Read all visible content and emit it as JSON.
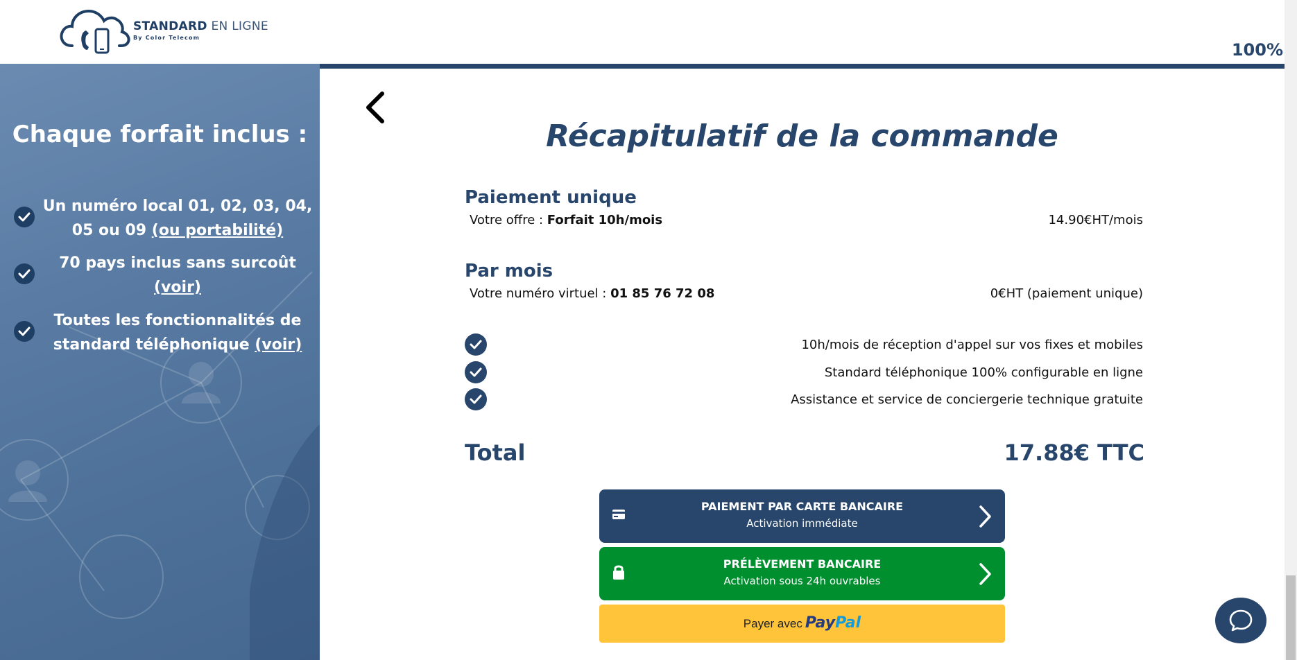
{
  "header": {
    "brand_bold": "STANDARD",
    "brand_light": "EN LIGNE",
    "brand_sub": "By Color Telecom",
    "logo_icon": "cloud-phone-icon",
    "progress_label": "100%",
    "progress_fraction": 1.0
  },
  "sidebar": {
    "title": "Chaque forfait inclus :",
    "features": [
      {
        "line1": "Un numéro local 01, 02, 03, 04,",
        "line2_text": "05 ou 09 ",
        "link": "(ou portabilité)"
      },
      {
        "line1": "70 pays inclus sans surcoût",
        "line2_text": "",
        "link": "(voir)"
      },
      {
        "line1": "Toutes les fonctionnalités de",
        "line2_text": "standard téléphonique ",
        "link": "(voir)"
      }
    ]
  },
  "main": {
    "back_icon": "chevron-left-icon",
    "title": "Récapitulatif de la commande",
    "once": {
      "title": "Paiement unique",
      "label": "Votre offre : ",
      "value": "Forfait 10h/mois",
      "amount": "14.90€HT/mois"
    },
    "monthly": {
      "title": "Par mois",
      "label": "Votre numéro virtuel : ",
      "value": "01 85 76 72 08",
      "amount": "0€HT (paiement unique)"
    },
    "included": [
      "10h/mois de réception d'appel sur vos fixes et mobiles",
      "Standard téléphonique 100% configurable en ligne",
      "Assistance et service de conciergerie technique gratuite"
    ],
    "total_label": "Total",
    "total_value": "17.88€ TTC",
    "btn_card": {
      "title": "PAIEMENT PAR CARTE BANCAIRE",
      "subtitle": "Activation immédiate",
      "icon": "credit-card-icon",
      "color": "#28466c"
    },
    "btn_debit": {
      "title": "PRÉLÈVEMENT BANCAIRE",
      "subtitle": "Activation sous 24h ouvrables",
      "icon": "lock-icon",
      "color": "#008f2f"
    },
    "btn_paypal": {
      "prefix": "Payer avec",
      "brand1": "Pay",
      "brand2": "Pal",
      "color": "#ffc439"
    }
  },
  "colors": {
    "primary": "#28466c",
    "green": "#008f2f",
    "paypal_yellow": "#ffc439"
  },
  "chat": {
    "icon": "chat-bubble-icon"
  }
}
